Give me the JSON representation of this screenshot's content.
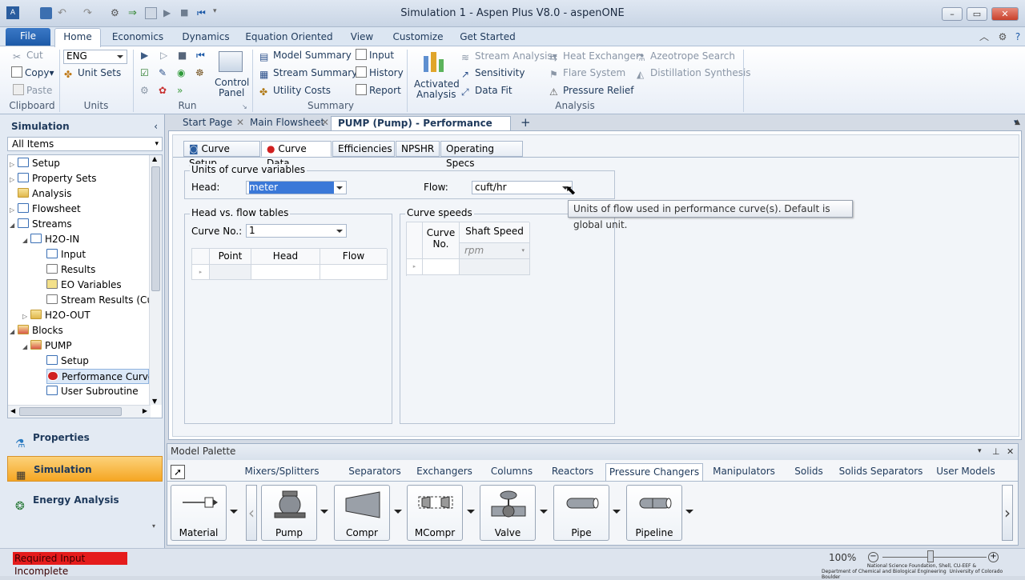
{
  "app": {
    "title": "Simulation 1 - Aspen Plus V8.0 - aspenONE",
    "window_controls": [
      "minimize",
      "restore",
      "close"
    ]
  },
  "ribbon_tabs": [
    "File",
    "Home",
    "Economics",
    "Dynamics",
    "Equation Oriented",
    "View",
    "Customize",
    "Get Started"
  ],
  "ribbon": {
    "clipboard": {
      "cut": "Cut",
      "copy": "Copy",
      "paste": "Paste",
      "label": "Clipboard"
    },
    "units": {
      "value": "ENG",
      "unit_sets": "Unit Sets",
      "label": "Units"
    },
    "run": {
      "control_panel_line1": "Control",
      "control_panel_line2": "Panel",
      "label": "Run"
    },
    "summary": {
      "model_summary": "Model Summary",
      "stream_summary": "Stream Summary",
      "utility_costs": "Utility Costs",
      "input": "Input",
      "history": "History",
      "report": "Report",
      "label": "Summary"
    },
    "analysis": {
      "activated_line1": "Activated",
      "activated_line2": "Analysis",
      "stream_analysis": "Stream Analysis",
      "sensitivity": "Sensitivity",
      "data_fit": "Data Fit",
      "heat_exchanger": "Heat Exchanger",
      "flare_system": "Flare System",
      "pressure_relief": "Pressure Relief",
      "azeotrope_search": "Azeotrope Search",
      "distillation_synthesis": "Distillation Synthesis",
      "label": "Analysis"
    }
  },
  "nav": {
    "header": "Simulation",
    "filter": "All Items",
    "tree": [
      "Setup",
      "Property Sets",
      "Analysis",
      "Flowsheet",
      "Streams",
      "H2O-IN",
      "Input",
      "Results",
      "EO Variables",
      "Stream Results (Cust",
      "H2O-OUT",
      "Blocks",
      "PUMP",
      "Setup",
      "Performance Curves",
      "User Subroutine"
    ],
    "buttons": [
      "Properties",
      "Simulation",
      "Energy Analysis"
    ]
  },
  "doc_tabs": [
    "Start Page",
    "Main Flowsheet",
    "PUMP (Pump) - Performance Curves"
  ],
  "sheet_tabs": [
    "Curve Setup",
    "Curve Data",
    "Efficiencies",
    "NPSHR",
    "Operating Specs"
  ],
  "form": {
    "units_group": "Units of curve variables",
    "head_label": "Head:",
    "head_value": "meter",
    "flow_label": "Flow:",
    "flow_value": "cuft/hr",
    "tooltip": "Units of flow used in performance curve(s). Default is global unit.",
    "tables_group": "Head vs. flow tables",
    "curve_no_label": "Curve No.:",
    "curve_no_value": "1",
    "table_headers": [
      "Point",
      "Head",
      "Flow"
    ],
    "speeds_group": "Curve speeds",
    "speed_header_curve_line1": "Curve",
    "speed_header_curve_line2": "No.",
    "speed_header_shaft": "Shaft Speed",
    "speed_unit": "rpm"
  },
  "palette": {
    "title": "Model Palette",
    "tabs": [
      "Mixers/Splitters",
      "Separators",
      "Exchangers",
      "Columns",
      "Reactors",
      "Pressure Changers",
      "Manipulators",
      "Solids",
      "Solids Separators",
      "User Models"
    ],
    "items": [
      "Material",
      "Pump",
      "Compr",
      "MCompr",
      "Valve",
      "Pipe",
      "Pipeline"
    ]
  },
  "status": {
    "message": "Required Input Incomplete",
    "zoom": "100%",
    "footer_line1": "National Science Foundation, Shell, CU-EEF &",
    "footer_line2": "Department of Chemical and Biological Engineering",
    "footer_line3": "University of Colorado Boulder"
  },
  "colors": {
    "accent": "#1d5aa8",
    "status_error": "#e51c1c"
  }
}
